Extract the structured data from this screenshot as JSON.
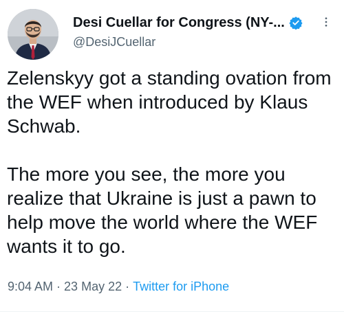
{
  "author": {
    "display_name": "Desi Cuellar for Congress (NY-...",
    "handle": "@DesiJCuellar",
    "verified_badge_icon": "verified-check-icon",
    "badge_color": "#1d9bf0"
  },
  "tweet": {
    "paragraphs": [
      "Zelenskyy got a standing ovation from the WEF when introduced by Klaus Schwab.",
      "The more you see, the more you realize that Ukraine is just a pawn to help move the world where the WEF wants it to go."
    ],
    "time": "9:04 AM",
    "date": "23 May 22",
    "separator": "·",
    "source": "Twitter for iPhone"
  },
  "icons": {
    "more_menu": "more-dots-icon"
  },
  "colors": {
    "text_primary": "#0f1419",
    "text_secondary": "#536471",
    "link": "#1d9bf0"
  }
}
